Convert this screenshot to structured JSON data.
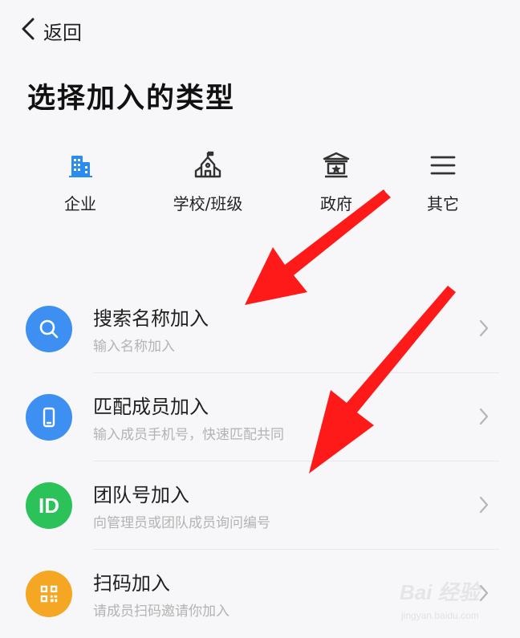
{
  "header": {
    "back_label": "返回"
  },
  "page_title": "选择加入的类型",
  "types": [
    {
      "label": "企业",
      "icon": "building-icon",
      "color": "#2a8cf0"
    },
    {
      "label": "学校/班级",
      "icon": "school-icon",
      "color": "#333333"
    },
    {
      "label": "政府",
      "icon": "government-icon",
      "color": "#333333"
    },
    {
      "label": "其它",
      "icon": "menu-icon",
      "color": "#333333"
    }
  ],
  "options": [
    {
      "title": "搜索名称加入",
      "subtitle": "输入名称加入",
      "icon": "search-icon",
      "color": "#3d8ff2"
    },
    {
      "title": "匹配成员加入",
      "subtitle": "输入成员手机号，快速匹配共同",
      "icon": "phone-icon",
      "color": "#3d8ff2"
    },
    {
      "title": "团队号加入",
      "subtitle": "向管理员或团队成员询问编号",
      "icon": "id-icon",
      "icon_text": "ID",
      "color": "#2cc25a"
    },
    {
      "title": "扫码加入",
      "subtitle": "请成员扫码邀请你加入",
      "icon": "qrcode-icon",
      "color": "#f5a623"
    }
  ],
  "annotation": {
    "arrow_color": "#ff1a1a"
  },
  "watermark": {
    "brand": "Bai 经验",
    "url": "jingyan.baidu.com"
  }
}
